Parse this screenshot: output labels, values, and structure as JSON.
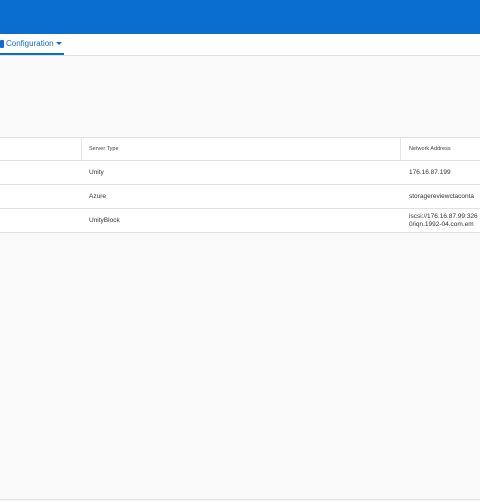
{
  "nav": {
    "config_label": "Configuration"
  },
  "table": {
    "headers": {
      "server_type": "Server Type",
      "network_address": "Network Address"
    },
    "rows": [
      {
        "server_type": "Unity",
        "address_line1": "176.16.87.199",
        "address_line2": ""
      },
      {
        "server_type": "Azure",
        "address_line1": "storagereviewctaconta",
        "address_line2": ""
      },
      {
        "server_type": "UnityBlock",
        "address_line1": "iscsi://176.16.87.99:326",
        "address_line2": "0/iqn.1992-04.com.em"
      }
    ]
  },
  "icons": {
    "config": "settings-icon",
    "caret": "chevron-down-icon"
  },
  "colors": {
    "brand": "#0a6ed1"
  }
}
